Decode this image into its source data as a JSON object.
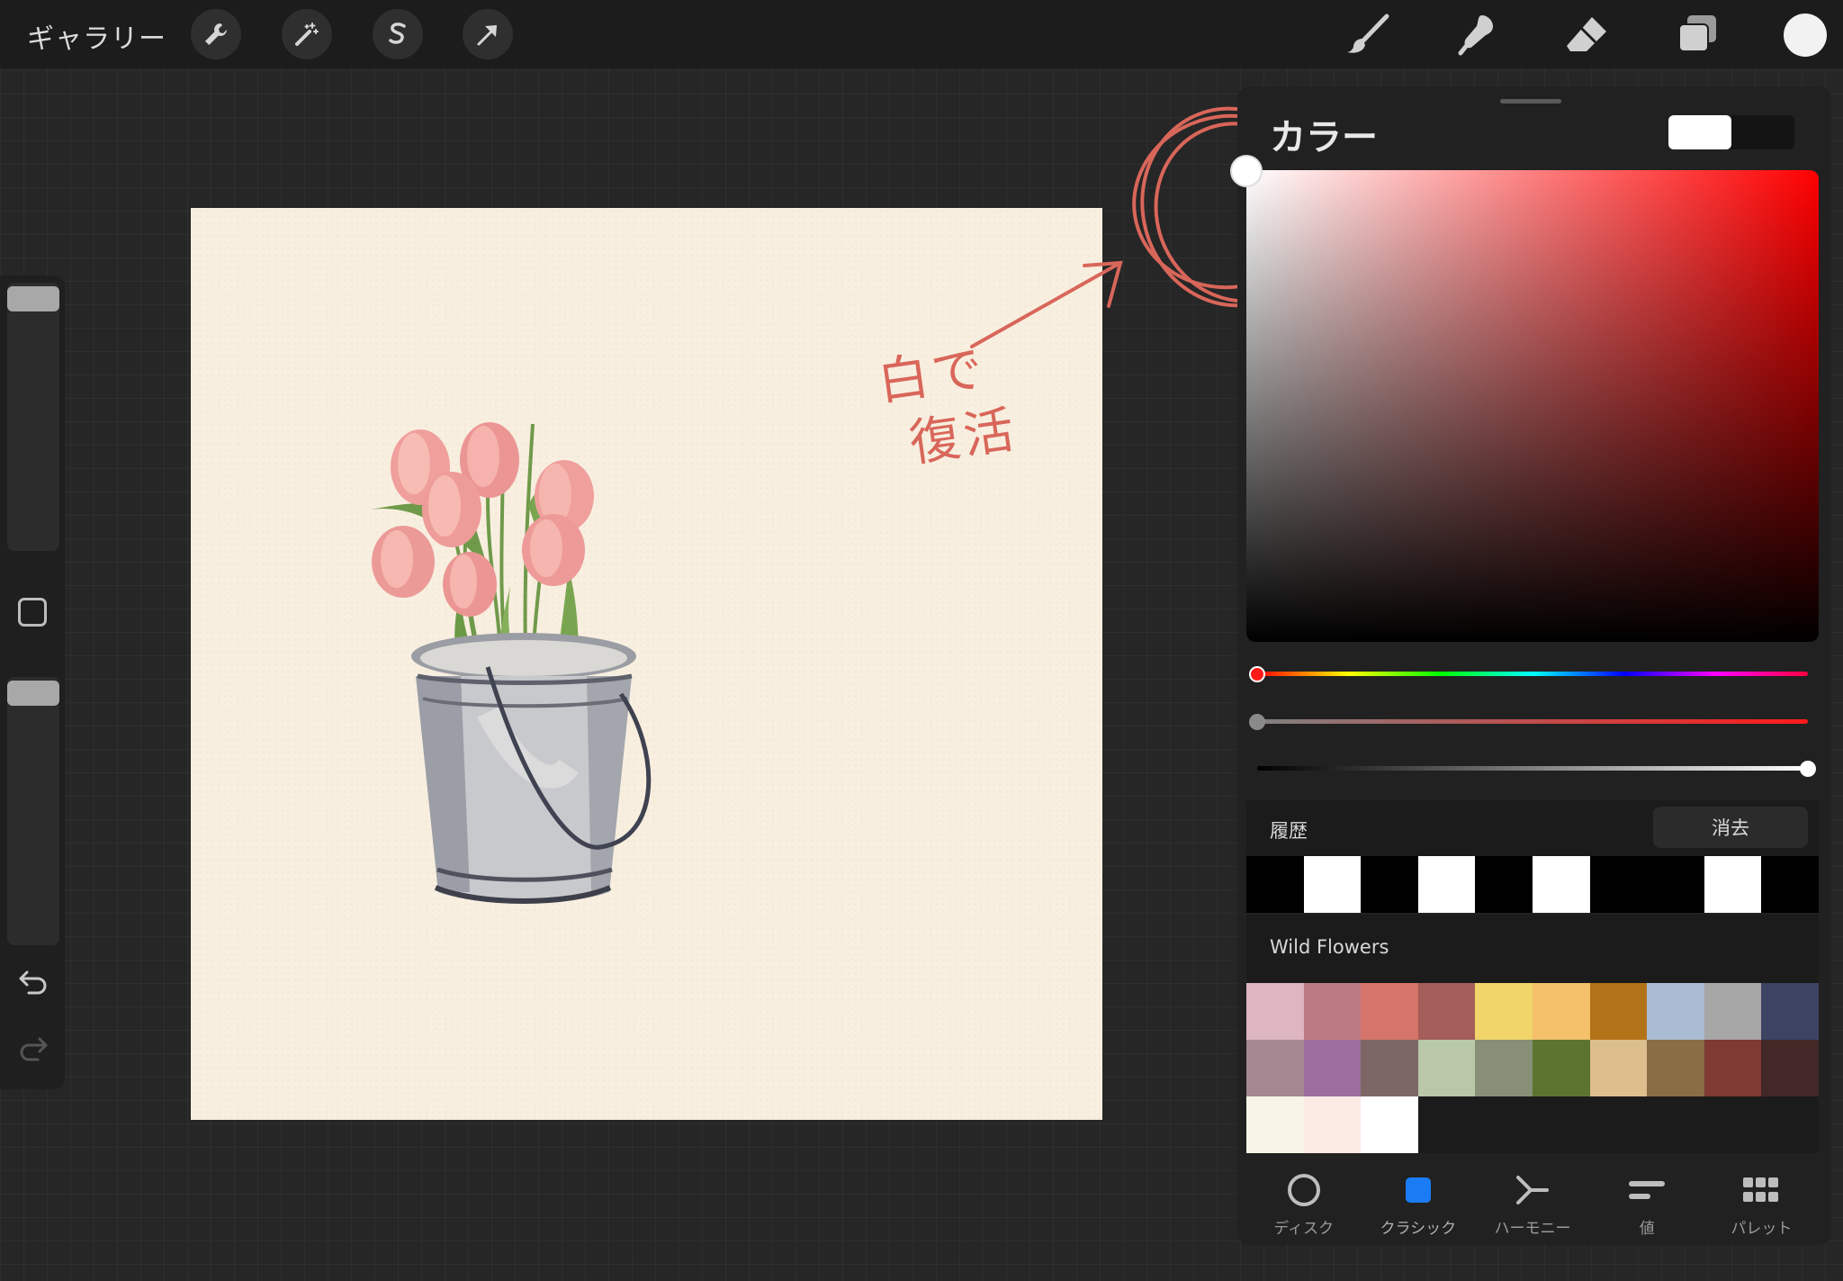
{
  "topbar": {
    "gallery_label": "ギャラリー",
    "left_tools": [
      "wrench-icon",
      "magic-wand-icon",
      "selection-icon",
      "transform-arrow-icon"
    ],
    "right_tools": [
      "brush-icon",
      "smudge-icon",
      "eraser-icon",
      "layers-icon"
    ],
    "current_color": "#f2f2f2"
  },
  "sidebar": {
    "brush_size_level": 0.95,
    "opacity_level": 0.95,
    "undo_icon": "undo-icon",
    "redo_icon": "redo-icon"
  },
  "canvas": {
    "background": "#f8efe0"
  },
  "annotation": {
    "line1": "白で",
    "line2": "復活",
    "color": "#d9665a"
  },
  "color_panel": {
    "title": "カラー",
    "primary_swatch": "#ffffff",
    "secondary_swatch": "#141414",
    "hue_level": 0.0,
    "saturation_level": 0.0,
    "brightness_level": 1.0,
    "history_label": "履歴",
    "clear_label": "消去",
    "history": [
      "#000000",
      "#ffffff",
      "#000000",
      "#ffffff",
      "#000000",
      "#ffffff",
      "#000000",
      "#000000",
      "#ffffff",
      "#000000"
    ],
    "palette_name": "Wild Flowers",
    "palette": [
      "#ddb6c0",
      "#bc7a84",
      "#d4746a",
      "#a45d58",
      "#f1d56a",
      "#f4c06a",
      "#b27218",
      "#a9bcd3",
      "#a7a7a7",
      "#3c4363",
      "#a48892",
      "#9c6e9e",
      "#7d6766",
      "#b8c8a9",
      "#878f76",
      "#5c742f",
      "#dcbf8c",
      "#8a6d45",
      "#7f3a34",
      "#422826",
      "#f8f4e6",
      "#fceae4",
      "#ffffff"
    ],
    "tabs": [
      {
        "label": "ディスク",
        "icon": "disc-icon"
      },
      {
        "label": "クラシック",
        "icon": "classic-square-icon"
      },
      {
        "label": "ハーモニー",
        "icon": "harmony-icon"
      },
      {
        "label": "値",
        "icon": "value-icon"
      },
      {
        "label": "パレット",
        "icon": "palette-grid-icon"
      }
    ],
    "active_tab": "クラシック",
    "accent": "#1a7cf5"
  }
}
